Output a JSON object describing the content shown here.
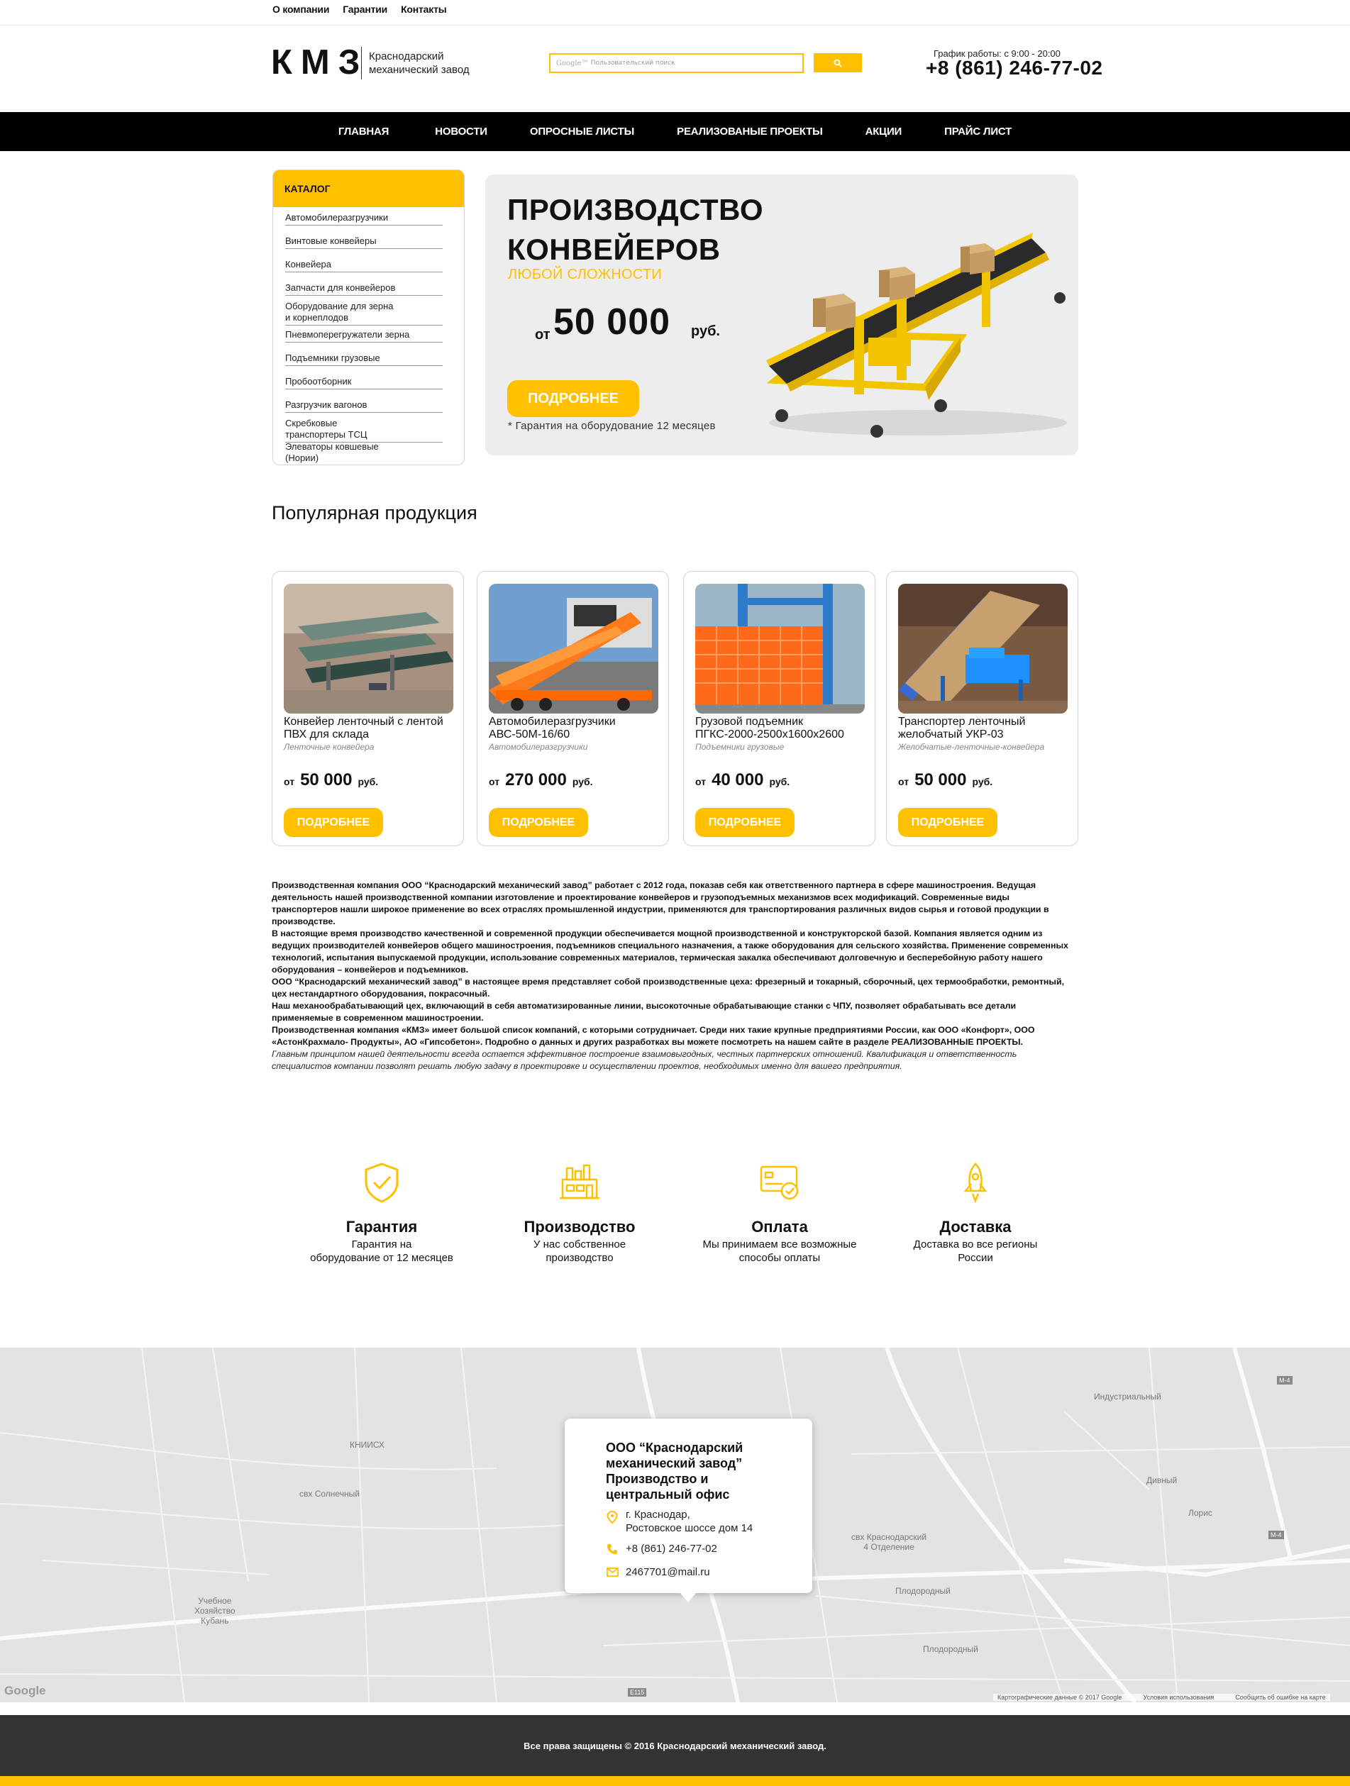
{
  "top_links": [
    "О компании",
    "Гарантии",
    "Контакты"
  ],
  "header": {
    "logo": "КМЗ",
    "logo_sub_1": "Краснодарский",
    "logo_sub_2": "механический завод",
    "search_brand": "Google™",
    "search_placeholder": "Пользовательский поиск",
    "search_icon": "search-icon",
    "worktime": "График работы: с 9:00 - 20:00",
    "phone": "+8 (861) 246-77-02"
  },
  "nav": [
    "ГЛАВНАЯ",
    "НОВОСТИ",
    "ОПРОСНЫЕ ЛИСТЫ",
    "РЕАЛИЗОВАНЫЕ ПРОЕКТЫ",
    "АКЦИИ",
    "ПРАЙС ЛИСТ"
  ],
  "catalog": {
    "title": "КАТАЛОГ",
    "items": [
      "Автомобилеразгрузчики",
      "Винтовые конвейеры",
      "Конвейера",
      "Запчасти для конвейеров",
      "Оборудование для зерна\nи корнеплодов",
      "Пневмоперегружатели зерна",
      "Подъемники грузовые",
      "Пробоотборник",
      "Разгрузчик вагонов",
      "Скребковые\nтранспортеры ТСЦ",
      "Элеваторы ковшевые\n(Нории)"
    ]
  },
  "hero": {
    "title_1": "ПРОИЗВОДСТВО",
    "title_2": "КОНВЕЙЕРОВ",
    "subtitle": "ЛЮБОЙ СЛОЖНОСТИ",
    "from": "от",
    "price": "50 000",
    "currency": "руб.",
    "button": "ПОДРОБНЕЕ",
    "note": "* Гарантия на оборудование 12 месяцев"
  },
  "popular": {
    "title": "Популярная продукция",
    "cards": [
      {
        "name": "Конвейер ленточный с лентой ПВХ для склада",
        "category": "Ленточные конвейера",
        "from": "от",
        "price": "50 000",
        "currency": "руб.",
        "button": "ПОДРОБНЕЕ"
      },
      {
        "name": "Автомобилеразгрузчики АВС-50М-16/60",
        "category": "Автомобилеразгрузчики",
        "from": "от",
        "price": "270 000",
        "currency": "руб.",
        "button": "ПОДРОБНЕЕ"
      },
      {
        "name": "Грузовой подъемник ПГКС-2000-2500х1600х2600",
        "category": "Подъемники грузовые",
        "from": "от",
        "price": "40 000",
        "currency": "руб.",
        "button": "ПОДРОБНЕЕ"
      },
      {
        "name": "Транспортер ленточный желобчатый УКР-03",
        "category": "Желобчатые-ленточные-конвейера",
        "from": "от",
        "price": "50 000",
        "currency": "руб.",
        "button": "ПОДРОБНЕЕ"
      }
    ]
  },
  "about": {
    "p1": "Производственная компания ООО “Краснодарский механический завод” работает с 2012 года, показав себя как ответственного партнера в сфере машиностроения. Ведущая деятельность нашей производственной компании изготовление и проектирование конвейеров и грузоподъемных механизмов всех модификаций. Современные виды транспортеров нашли широкое применение во всех отраслях промышленной индустрии, применяются для транспортирования различных видов сырья и готовой продукции в производстве.",
    "p2": "В настоящие время производство качественной и современной продукции обеспечивается мощной производственной и конструкторской базой. Компания является одним из ведущих производителей конвейеров общего машиностроения, подъемников специального назначения, а также оборудования для сельского хозяйства. Применение современных технологий, испытания выпускаемой продукции, использование современных материалов, термическая закалка обеспечивают долговечную и бесперебойную работу нашего оборудования – конвейеров и подъемников.",
    "p3": "ООО “Краснодарский механический завод” в настоящее время представляет собой производственные цеха: фрезерный и токарный, сборочный, цех термообработки, ремонтный, цех нестандартного оборудования, покрасочный.",
    "p4": "Наш механообрабатывающий цех, включающий в себя автоматизированные линии, высокоточные обрабатывающие станки с ЧПУ, позволяет обрабатывать все детали применяемые в современном машиностроении.",
    "p5": "Производственная компания «КМЗ» имеет большой список компаний, с которыми сотрудничает. Среди них такие крупные предприятиями России, как ООО «Конфорт», ООО «АстонКрахмало- Продукты», АО «Гипсобетон». Подробно о данных и других разработках вы можете посмотреть на нашем сайте в разделе РЕАЛИЗОВАННЫЕ ПРОЕКТЫ.",
    "p6": "Главным принципом нашей деятельности всегда остается эффективное построение взаимовыгодных, честных партнерских отношений. Квалификация и ответственность специалистов компании позволят решать любую задачу в проектировке и осуществлении проектов, необходимых именно для вашего предприятия."
  },
  "features": [
    {
      "icon": "shield-check-icon",
      "title": "Гарантия",
      "desc_1": "Гарантия на",
      "desc_2": "оборудование от 12 месяцев"
    },
    {
      "icon": "factory-icon",
      "title": "Производство",
      "desc_1": "У нас собственное",
      "desc_2": "производство"
    },
    {
      "icon": "payment-card-icon",
      "title": "Оплата",
      "desc_1": "Мы принимаем все возможные",
      "desc_2": "способы оплаты"
    },
    {
      "icon": "rocket-icon",
      "title": "Доставка",
      "desc_1": "Доставка во все регионы",
      "desc_2": "России"
    }
  ],
  "map": {
    "labels": {
      "industrialny": "Индустриальный",
      "knnisx": "КНИИСХ",
      "solnechny": "свх Солнечный",
      "divny": "Дивный",
      "loris": "Лорис",
      "krasnodarsky_1": "свх Краснодарский",
      "krasnodarsky_2": "4 Отделение",
      "plodorodny_1": "Плодородный",
      "plodorodny_2": "Плодородный",
      "uchebnoe_1": "Учебное",
      "uchebnoe_2": "Хозяйство",
      "uchebnoe_3": "Кубань",
      "m4_a": "М-4",
      "m4_b": "М-4",
      "e115": "Е115"
    },
    "google": "Google",
    "attribution": "Картографические данные © 2017 Google",
    "terms": "Условия использования",
    "report": "Сообщить об ошибке на карте",
    "card_title_1": "ООО “Краснодарский",
    "card_title_2": "механический завод”",
    "card_title_3": "Производство и",
    "card_title_4": "центральный офис",
    "address_1": "г. Краснодар,",
    "address_2": "Ростовское шоссе дом 14",
    "phone": "+8 (861) 246-77-02",
    "email": "2467701@mail.ru"
  },
  "footer": {
    "copyright": "Все права защищены © 2016 Краснодарский механический завод."
  },
  "colors": {
    "accent": "#ffc000",
    "nav_bg": "#000000",
    "footer_bg": "#333333"
  }
}
